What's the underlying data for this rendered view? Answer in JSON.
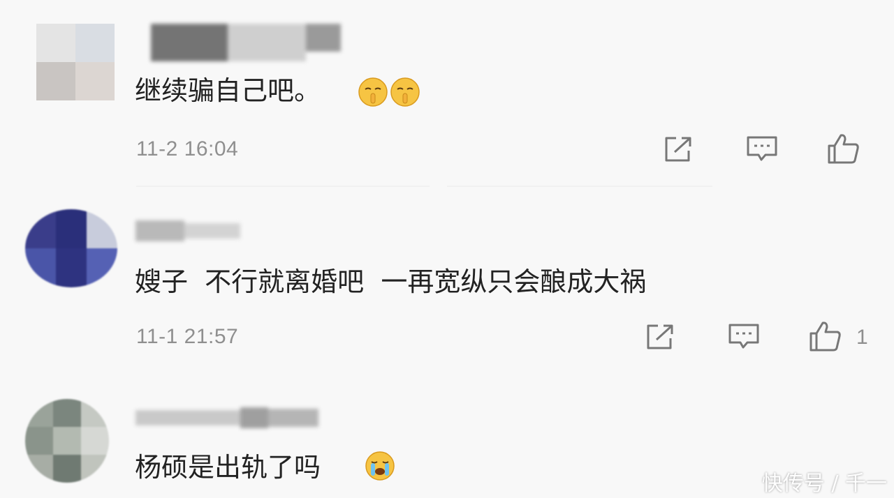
{
  "comments": [
    {
      "text": "继续骗自己吧。",
      "emojis": [
        "shush-face-emoji",
        "shush-face-emoji"
      ],
      "time": "11-2 16:04",
      "likes": ""
    },
    {
      "text": "嫂子  不行就离婚吧  一再宽纵只会酿成大祸",
      "emojis": [],
      "time": "11-1 21:57",
      "likes": "1"
    },
    {
      "text": "杨硕是出轨了吗",
      "emojis": [
        "crying-face-emoji"
      ],
      "time": "",
      "likes": ""
    }
  ],
  "icons": {
    "share": "share-icon",
    "reply": "comment-icon",
    "like": "thumbs-up-icon"
  },
  "watermark": "快传号 / 千一",
  "colors": {
    "background": "#f8f8f8",
    "text": "#222222",
    "meta": "#8f8f8f",
    "icon": "#777777"
  }
}
